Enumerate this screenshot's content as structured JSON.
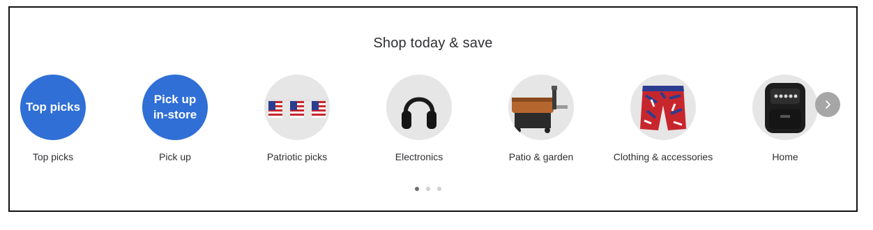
{
  "section": {
    "title": "Shop today & save"
  },
  "categories": [
    {
      "label": "Top picks",
      "circle_text": "Top picks",
      "icon": "top-picks-badge"
    },
    {
      "label": "Pick up",
      "circle_text": "Pick up\nin-store",
      "icon": "pick-up-badge"
    },
    {
      "label": "Patriotic picks",
      "icon": "flag-bunting-icon"
    },
    {
      "label": "Electronics",
      "icon": "headphones-icon"
    },
    {
      "label": "Patio & garden",
      "icon": "grill-icon"
    },
    {
      "label": "Clothing & accessories",
      "icon": "shorts-icon"
    },
    {
      "label": "Home",
      "icon": "air-fryer-icon"
    }
  ],
  "carousel": {
    "page_count": 3,
    "active_page": 1,
    "next_icon": "chevron-right-icon"
  },
  "colors": {
    "accent_blue": "#2f6fd6",
    "circle_bg": "#e6e6e6"
  }
}
